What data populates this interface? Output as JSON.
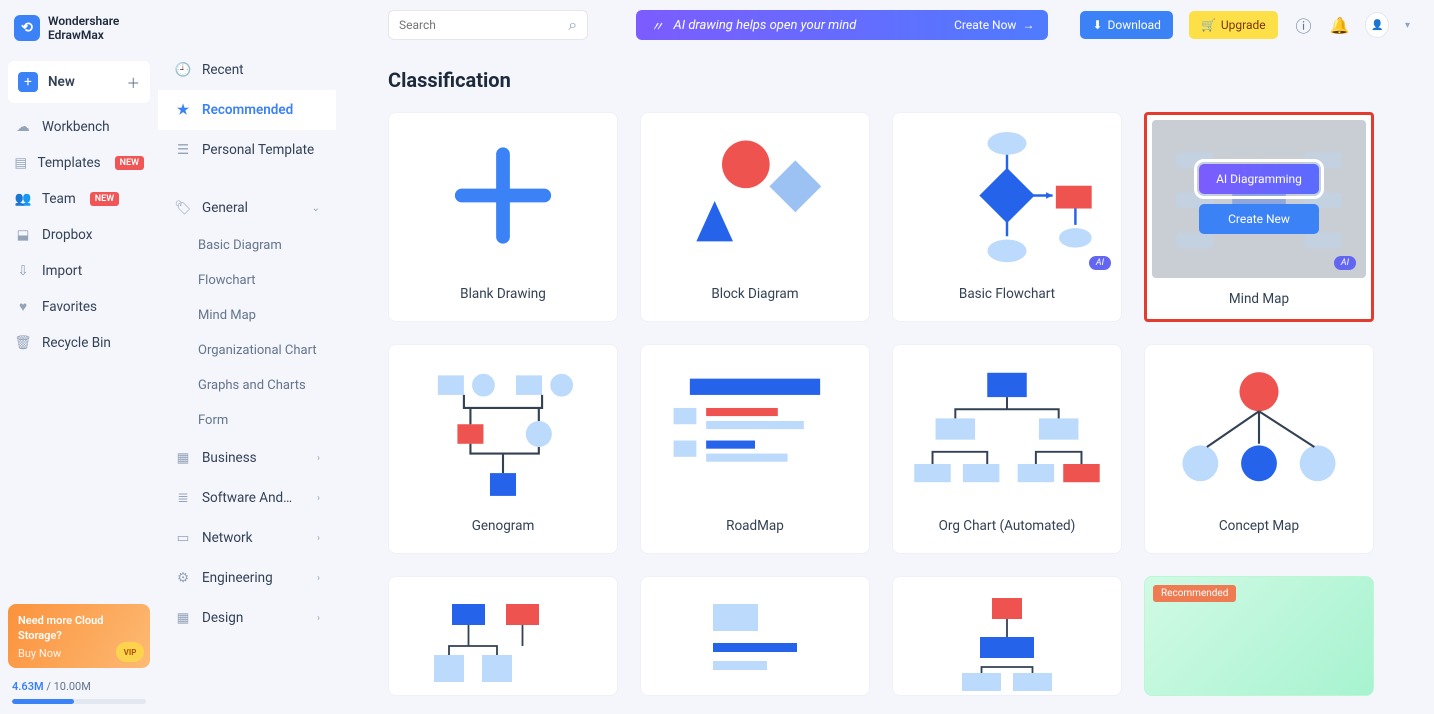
{
  "app": {
    "brand_line1": "Wondershare",
    "brand_line2": "EdrawMax"
  },
  "sidebar_left": {
    "new": "New",
    "items": [
      {
        "label": "Workbench"
      },
      {
        "label": "Templates",
        "badge": "NEW"
      },
      {
        "label": "Team",
        "badge": "NEW"
      },
      {
        "label": "Dropbox"
      },
      {
        "label": "Import"
      },
      {
        "label": "Favorites"
      },
      {
        "label": "Recycle Bin"
      }
    ],
    "promo_title": "Need more Cloud Storage?",
    "promo_buy": "Buy Now",
    "storage_used": "4.63M",
    "storage_total": "10.00M"
  },
  "sidebar_mid": {
    "top": [
      "Recent",
      "Recommended",
      "Personal Template"
    ],
    "general": "General",
    "general_subs": [
      "Basic Diagram",
      "Flowchart",
      "Mind Map",
      "Organizational Chart",
      "Graphs and Charts",
      "Form"
    ],
    "cats": [
      "Business",
      "Software And…",
      "Network",
      "Engineering",
      "Design"
    ]
  },
  "topbar": {
    "search_placeholder": "Search",
    "ai_banner": "AI drawing helps open your mind",
    "create_now": "Create Now",
    "download": "Download",
    "upgrade": "Upgrade"
  },
  "main": {
    "title": "Classification",
    "ai_tag": "AI",
    "overlay_ai": "AI Diagramming",
    "overlay_new": "Create New",
    "rec_badge": "Recommended",
    "cards": [
      {
        "label": "Blank Drawing"
      },
      {
        "label": "Block Diagram"
      },
      {
        "label": "Basic Flowchart",
        "ai": true
      },
      {
        "label": "Mind Map",
        "ai": true,
        "highlight": true
      },
      {
        "label": "Genogram"
      },
      {
        "label": "RoadMap"
      },
      {
        "label": "Org Chart (Automated)"
      },
      {
        "label": "Concept Map"
      }
    ]
  }
}
